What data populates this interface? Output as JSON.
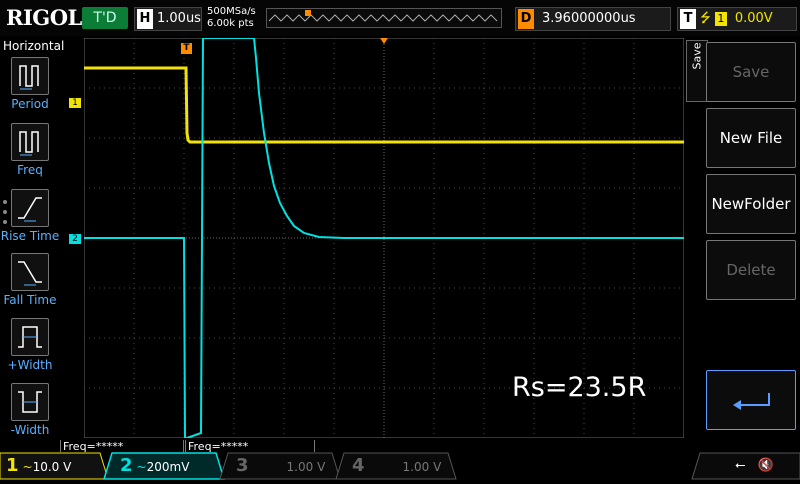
{
  "topbar": {
    "logo": "RIGOL",
    "run_status": "T'D",
    "horiz_key": "H",
    "timebase": "1.00us",
    "sample_rate": "500MSa/s",
    "memory_depth": "6.00k pts",
    "delay_key": "D",
    "delay": "3.96000000us",
    "trig_key": "T",
    "trig_channel": "1",
    "trig_level": "0.00V"
  },
  "left_menu": {
    "title": "Horizontal",
    "items": [
      {
        "label": "Period",
        "icon": "period-icon"
      },
      {
        "label": "Freq",
        "icon": "freq-icon"
      },
      {
        "label": "Rise Time",
        "icon": "rise-time-icon"
      },
      {
        "label": "Fall Time",
        "icon": "fall-time-icon"
      },
      {
        "label": "+Width",
        "icon": "pos-width-icon"
      },
      {
        "label": "-Width",
        "icon": "neg-width-icon"
      }
    ]
  },
  "screen": {
    "ch1_marker": "1",
    "ch2_marker": "2",
    "trigger_marker": "T",
    "annotation": "Rs=23.5R",
    "freq1": "Freq=*****",
    "freq2": "Freq=*****"
  },
  "right_menu": {
    "tab_label": "Save",
    "items": [
      {
        "label": "Save",
        "enabled": false
      },
      {
        "label": "New File",
        "enabled": true
      },
      {
        "label": "NewFolder",
        "enabled": true
      },
      {
        "label": "Delete",
        "enabled": false
      }
    ],
    "back_icon": "return-arrow-icon"
  },
  "bottombar": {
    "ch1": {
      "num": "1",
      "coupling": "~",
      "scale": "10.0 V",
      "color": "#f2e300"
    },
    "ch2": {
      "num": "2",
      "coupling": "~",
      "scale": "200mV",
      "color": "#00e1e1"
    },
    "ch3": {
      "num": "3",
      "scale": "1.00 V",
      "color": "#c8329a"
    },
    "ch4": {
      "num": "4",
      "scale": "1.00 V",
      "color": "#3c6cff"
    }
  },
  "colors": {
    "ch1": "#f2e300",
    "ch2": "#00e1e1",
    "trigger": "#ff8c00",
    "grid": "#5a5a5a"
  }
}
